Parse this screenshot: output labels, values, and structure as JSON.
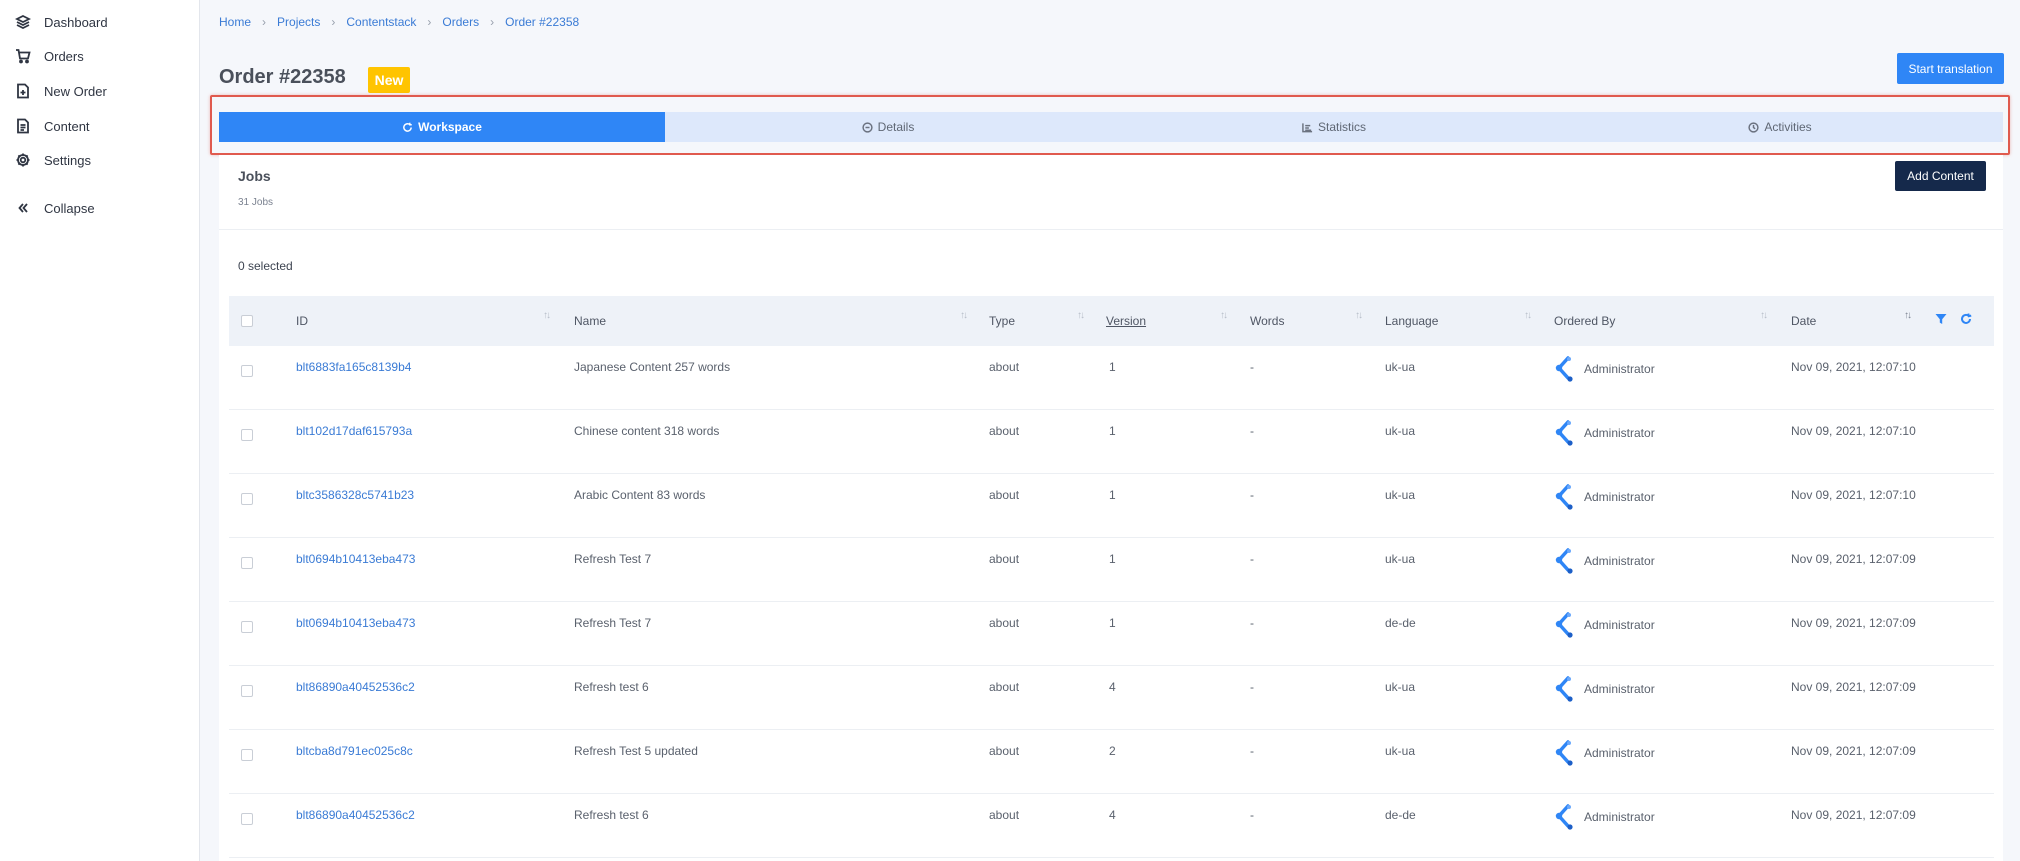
{
  "sidebar": {
    "items": [
      {
        "label": "Dashboard",
        "icon": "layers-icon"
      },
      {
        "label": "Orders",
        "icon": "cart-icon"
      },
      {
        "label": "New Order",
        "icon": "file-plus-icon"
      },
      {
        "label": "Content",
        "icon": "document-icon"
      },
      {
        "label": "Settings",
        "icon": "gear-icon"
      }
    ],
    "collapse_label": "Collapse"
  },
  "breadcrumb": [
    "Home",
    "Projects",
    "Contentstack",
    "Orders",
    "Order #22358"
  ],
  "header": {
    "title": "Order #22358",
    "status": "New",
    "start_button": "Start translation"
  },
  "tabs": [
    {
      "label": "Workspace",
      "icon": "refresh-icon",
      "active": true
    },
    {
      "label": "Details",
      "icon": "info-icon",
      "active": false
    },
    {
      "label": "Statistics",
      "icon": "chart-icon",
      "active": false
    },
    {
      "label": "Activities",
      "icon": "clock-icon",
      "active": false
    }
  ],
  "jobs": {
    "title": "Jobs",
    "count": "31 Jobs",
    "add_button": "Add Content",
    "selected": "0 selected"
  },
  "table": {
    "columns": [
      "ID",
      "Name",
      "Type",
      "Version",
      "Words",
      "Language",
      "Ordered By",
      "Date"
    ],
    "rows": [
      {
        "id": "blt6883fa165c8139b4",
        "name": "Japanese Content 257 words",
        "type": "about",
        "version": "1",
        "words": "-",
        "language": "uk-ua",
        "ordered_by": "Administrator",
        "date": "Nov 09, 2021, 12:07:10"
      },
      {
        "id": "blt102d17daf615793a",
        "name": "Chinese content 318 words",
        "type": "about",
        "version": "1",
        "words": "-",
        "language": "uk-ua",
        "ordered_by": "Administrator",
        "date": "Nov 09, 2021, 12:07:10"
      },
      {
        "id": "bltc3586328c5741b23",
        "name": "Arabic Content 83 words",
        "type": "about",
        "version": "1",
        "words": "-",
        "language": "uk-ua",
        "ordered_by": "Administrator",
        "date": "Nov 09, 2021, 12:07:10"
      },
      {
        "id": "blt0694b10413eba473",
        "name": "Refresh Test 7",
        "type": "about",
        "version": "1",
        "words": "-",
        "language": "uk-ua",
        "ordered_by": "Administrator",
        "date": "Nov 09, 2021, 12:07:09"
      },
      {
        "id": "blt0694b10413eba473",
        "name": "Refresh Test 7",
        "type": "about",
        "version": "1",
        "words": "-",
        "language": "de-de",
        "ordered_by": "Administrator",
        "date": "Nov 09, 2021, 12:07:09"
      },
      {
        "id": "blt86890a40452536c2",
        "name": "Refresh test 6",
        "type": "about",
        "version": "4",
        "words": "-",
        "language": "uk-ua",
        "ordered_by": "Administrator",
        "date": "Nov 09, 2021, 12:07:09"
      },
      {
        "id": "bltcba8d791ec025c8c",
        "name": "Refresh Test 5 updated",
        "type": "about",
        "version": "2",
        "words": "-",
        "language": "uk-ua",
        "ordered_by": "Administrator",
        "date": "Nov 09, 2021, 12:07:09"
      },
      {
        "id": "blt86890a40452536c2",
        "name": "Refresh test 6",
        "type": "about",
        "version": "4",
        "words": "-",
        "language": "de-de",
        "ordered_by": "Administrator",
        "date": "Nov 09, 2021, 12:07:09"
      }
    ]
  },
  "colors": {
    "accent": "#2f86f6",
    "badge": "#ffc400",
    "dark_button": "#15294b",
    "highlight_frame": "#e05a4e"
  }
}
